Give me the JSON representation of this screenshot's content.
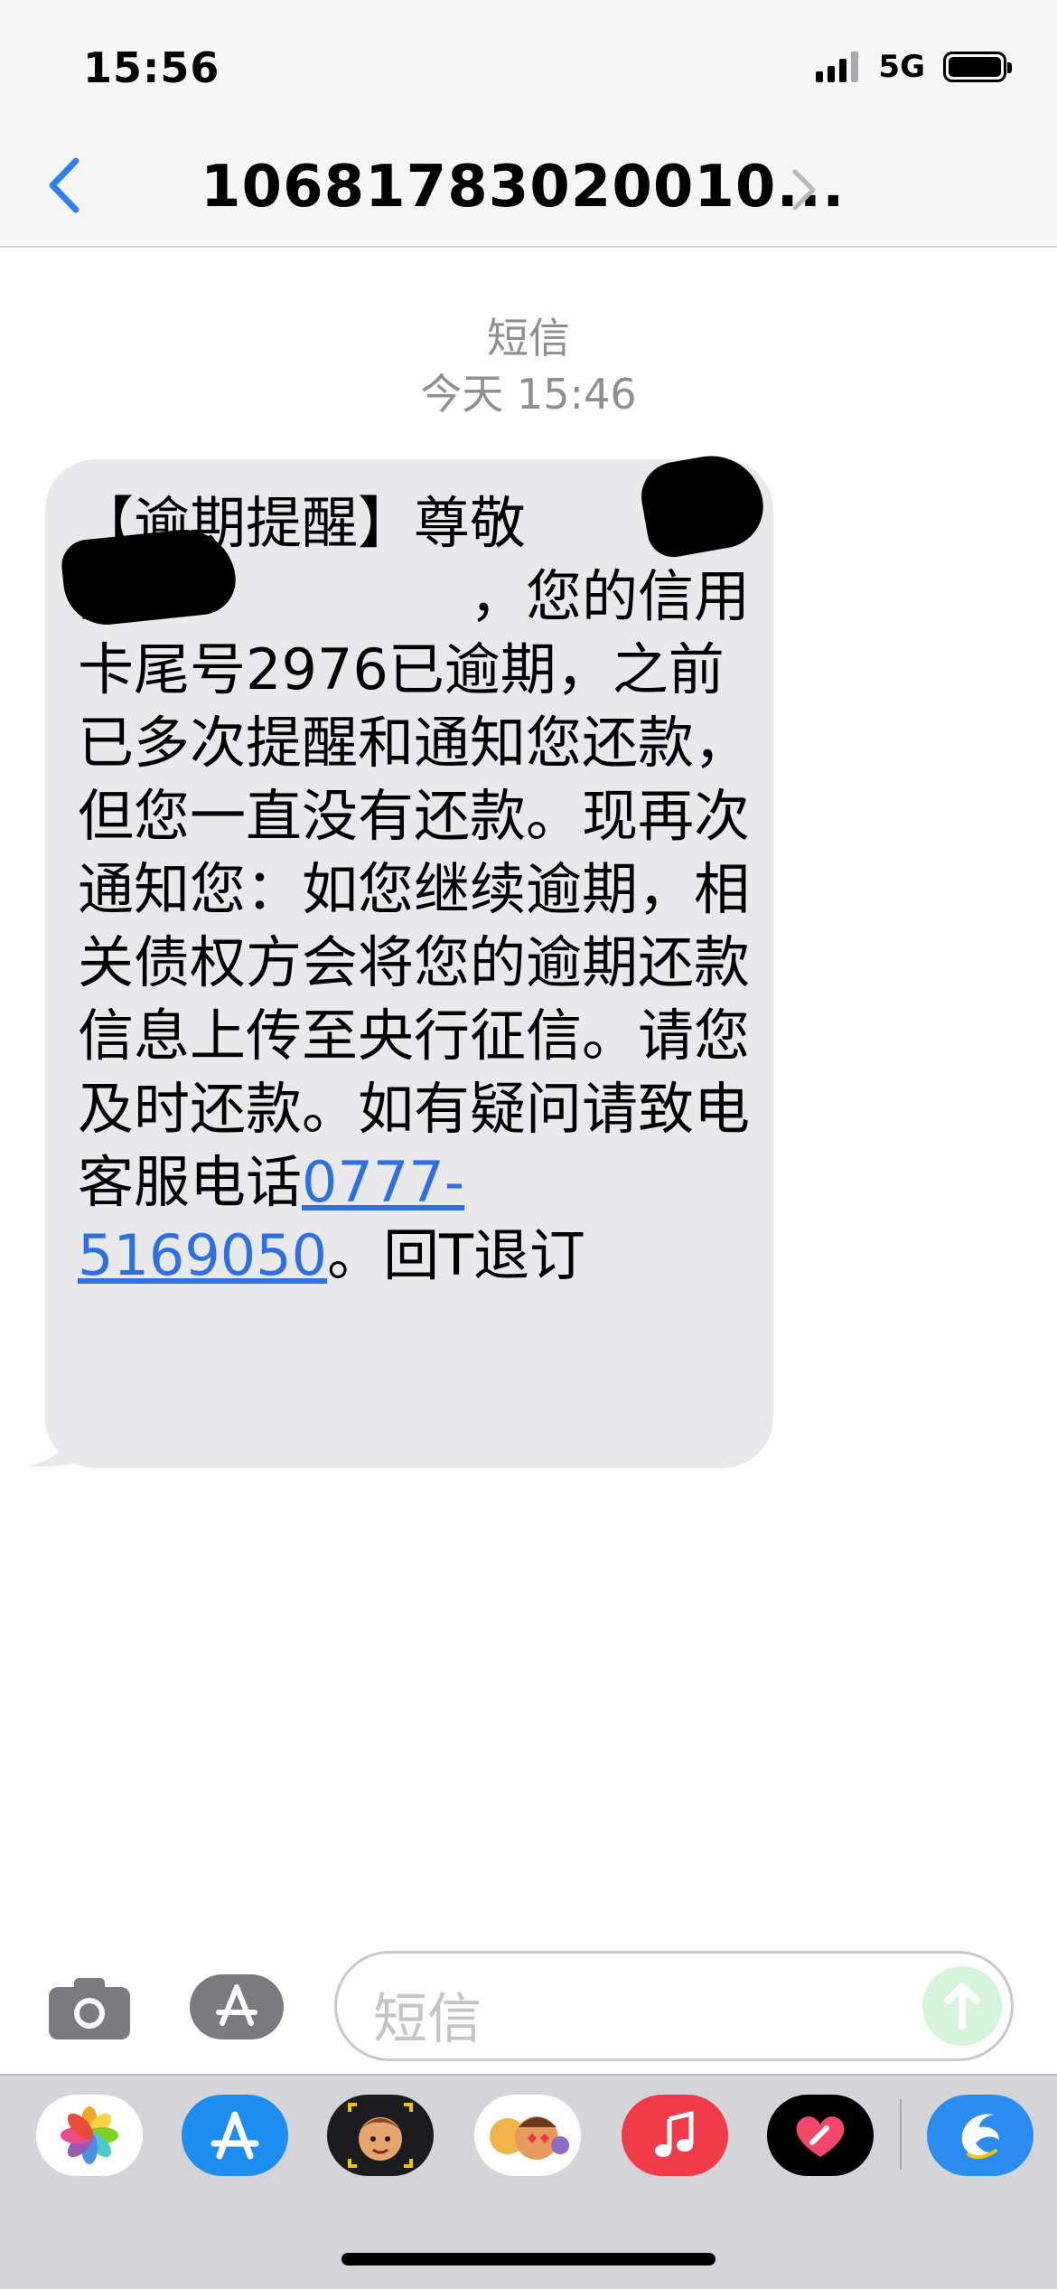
{
  "status_bar": {
    "time": "15:56",
    "network": "5G",
    "battery_level": 1.0
  },
  "nav": {
    "back_icon": "chevron-left-icon",
    "contact_title": "10681783020010...",
    "detail_icon": "chevron-right-icon"
  },
  "thread": {
    "service": "短信",
    "timestamp": "今天 15:46"
  },
  "message": {
    "text_before": "【逾期提醒】尊敬的　　　　　　，您的信用卡尾号2976已逾期，之前已多次提醒和通知您还款，但您一直没有还款。现再次通知您：如您继续逾期，相关债权方会将您的逾期还款信息上传至央行征信。请您及时还款。如有疑问请致电客服电话",
    "phone": "0777-5169050",
    "text_after": "。回T退订"
  },
  "composer": {
    "camera_icon": "camera-icon",
    "apps_icon": "app-store-icon",
    "placeholder": "短信",
    "send_icon": "arrow-up-icon"
  },
  "app_drawer": [
    {
      "name": "photos-icon"
    },
    {
      "name": "app-store-icon"
    },
    {
      "name": "memoji-icon"
    },
    {
      "name": "animoji-icon"
    },
    {
      "name": "music-icon"
    },
    {
      "name": "digital-touch-icon"
    },
    {
      "name": "dolphin-app-icon"
    }
  ],
  "colors": {
    "accent": "#2f6fe0",
    "bubble": "#e9e9eb",
    "send_button": "#d6f3dc"
  }
}
